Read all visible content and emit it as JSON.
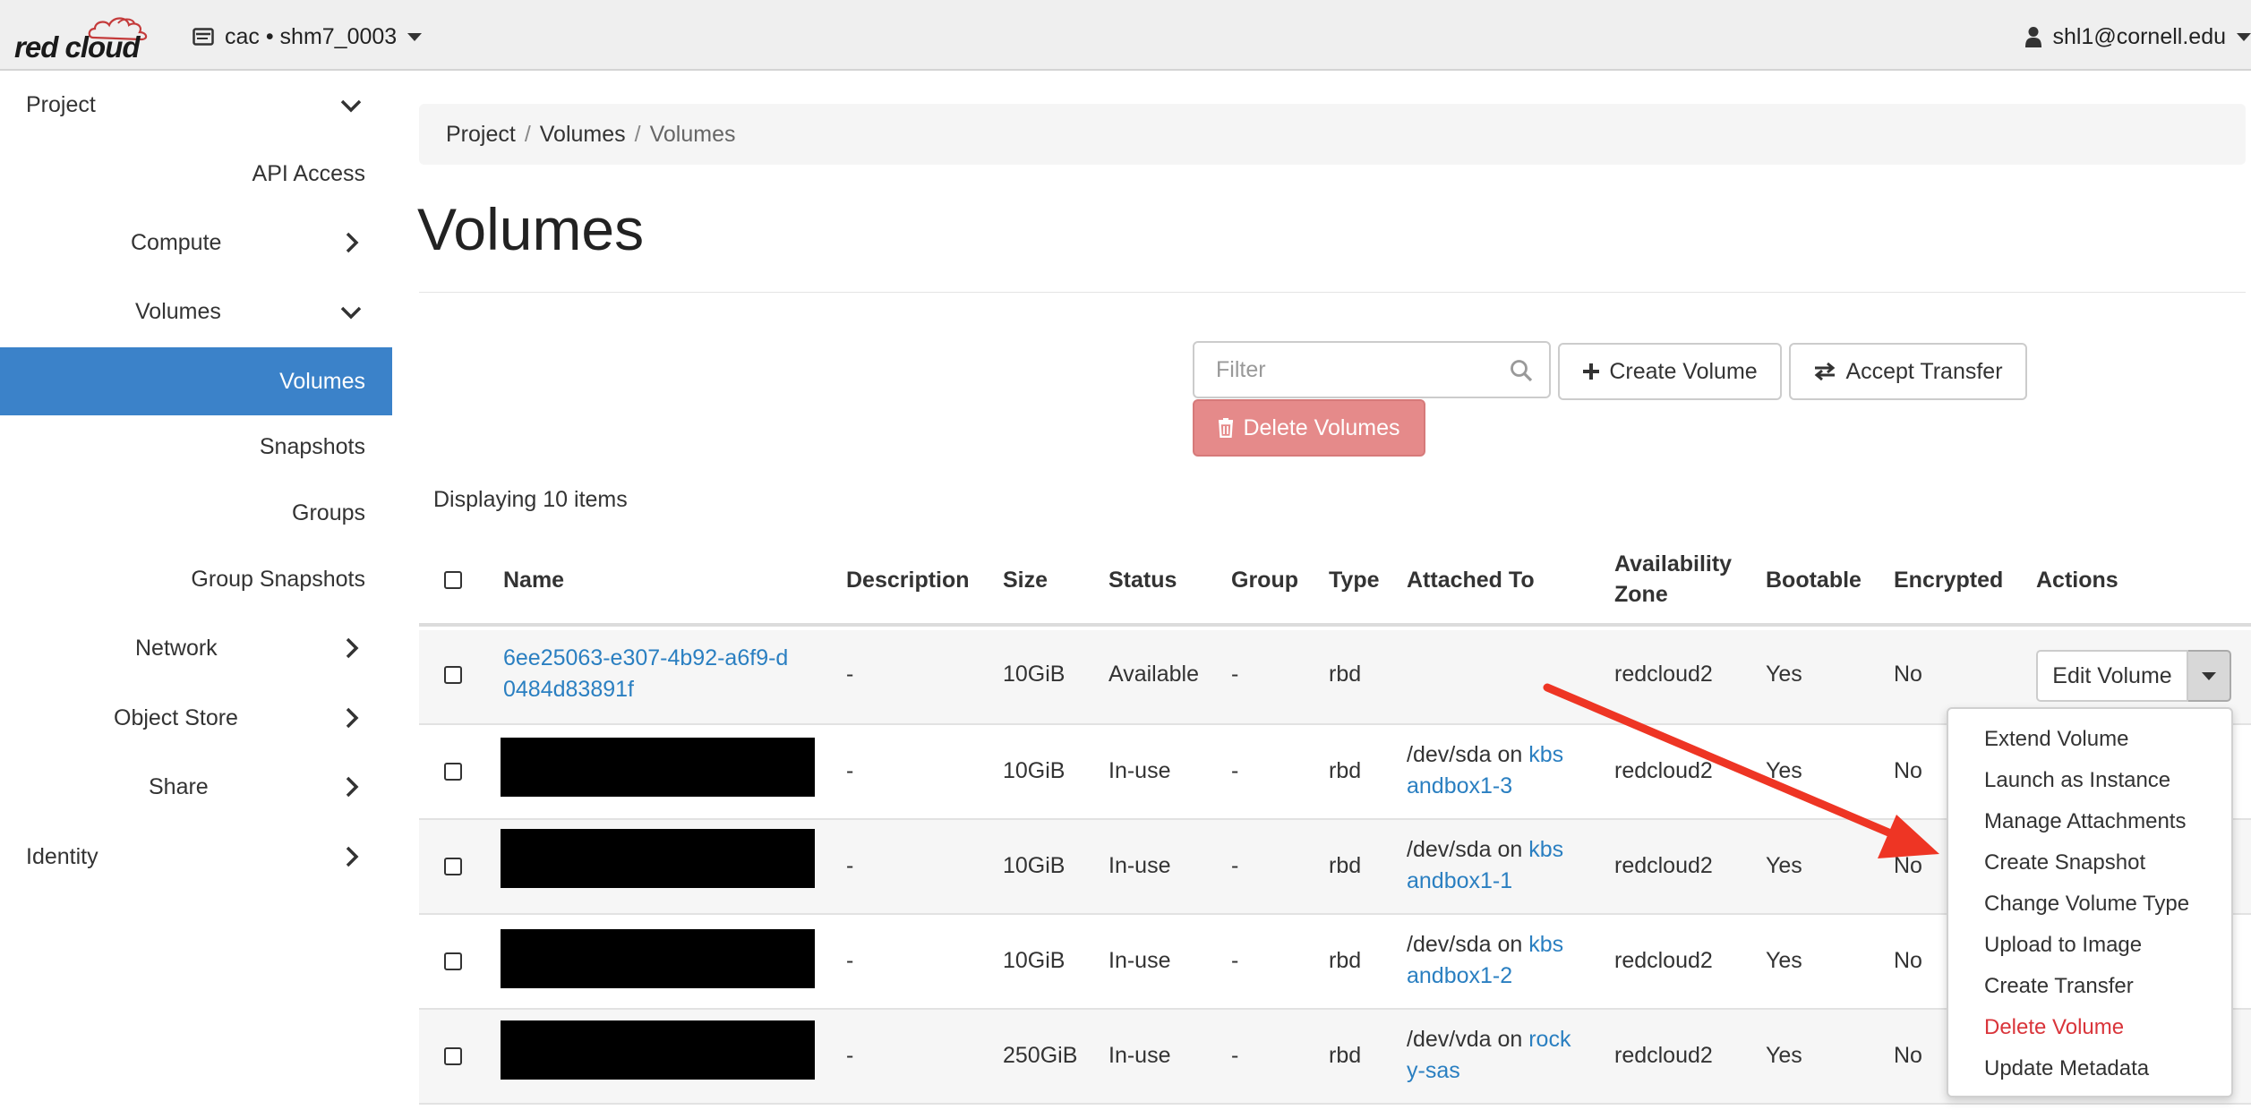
{
  "brand": {
    "name": "red cloud"
  },
  "header": {
    "project_label": "cac • shm7_0003",
    "user_label": "shl1@cornell.edu"
  },
  "sidebar": {
    "project": "Project",
    "api_access": "API Access",
    "compute": "Compute",
    "volumes_group": "Volumes",
    "volumes": "Volumes",
    "snapshots": "Snapshots",
    "groups": "Groups",
    "group_snapshots": "Group Snapshots",
    "network": "Network",
    "object_store": "Object Store",
    "share": "Share",
    "identity": "Identity"
  },
  "breadcrumb": [
    "Project",
    "Volumes",
    "Volumes"
  ],
  "page": {
    "title": "Volumes"
  },
  "toolbar": {
    "filter_placeholder": "Filter",
    "create_volume": "Create Volume",
    "accept_transfer": "Accept Transfer",
    "delete_volumes": "Delete Volumes"
  },
  "table": {
    "count": "Displaying 10 items",
    "headers": {
      "name": "Name",
      "description": "Description",
      "size": "Size",
      "status": "Status",
      "group": "Group",
      "type": "Type",
      "attached_to": "Attached To",
      "az_line1": "Availability",
      "az_line2": "Zone",
      "bootable": "Bootable",
      "encrypted": "Encrypted",
      "actions": "Actions"
    },
    "rows": [
      {
        "name1": "6ee25063-e307-4b92-a6f9-d",
        "name2": "0484d83891f",
        "description": "-",
        "size": "10GiB",
        "status": "Available",
        "group": "-",
        "type": "rbd",
        "attach_prefix": "",
        "attach_link1": "",
        "attach_link2": "",
        "az": "redcloud2",
        "bootable": "Yes",
        "encrypted": "No"
      },
      {
        "description": "-",
        "size": "10GiB",
        "status": "In-use",
        "group": "-",
        "type": "rbd",
        "attach_prefix": "/dev/sda on",
        "attach_link1": "kbs",
        "attach_link2": "andbox1-3",
        "az": "redcloud2",
        "bootable": "Yes",
        "encrypted": "No"
      },
      {
        "description": "-",
        "size": "10GiB",
        "status": "In-use",
        "group": "-",
        "type": "rbd",
        "attach_prefix": "/dev/sda on",
        "attach_link1": "kbs",
        "attach_link2": "andbox1-1",
        "az": "redcloud2",
        "bootable": "Yes",
        "encrypted": "No"
      },
      {
        "description": "-",
        "size": "10GiB",
        "status": "In-use",
        "group": "-",
        "type": "rbd",
        "attach_prefix": "/dev/sda on",
        "attach_link1": "kbs",
        "attach_link2": "andbox1-2",
        "az": "redcloud2",
        "bootable": "Yes",
        "encrypted": "No"
      },
      {
        "description": "-",
        "size": "250GiB",
        "status": "In-use",
        "group": "-",
        "type": "rbd",
        "attach_prefix": "/dev/vda on",
        "attach_link1": "rock",
        "attach_link2": "y-sas",
        "az": "redcloud2",
        "bootable": "Yes",
        "encrypted": "No"
      }
    ]
  },
  "actions": {
    "edit_volume": "Edit Volume",
    "menu": [
      "Extend Volume",
      "Launch as Instance",
      "Manage Attachments",
      "Create Snapshot",
      "Change Volume Type",
      "Upload to Image",
      "Create Transfer",
      "Delete Volume",
      "Update Metadata"
    ]
  },
  "colors": {
    "nav_active": "#3b82c9",
    "link": "#2a7fc1",
    "danger_button": "#e58a8a",
    "danger_text": "#d9343a",
    "annotation_arrow": "#ee3524"
  },
  "icons": {
    "project_switch": "server-icon",
    "user": "user-icon",
    "filter": "search-icon",
    "create": "plus-icon",
    "transfer": "exchange-icon",
    "delete": "trash-icon"
  }
}
